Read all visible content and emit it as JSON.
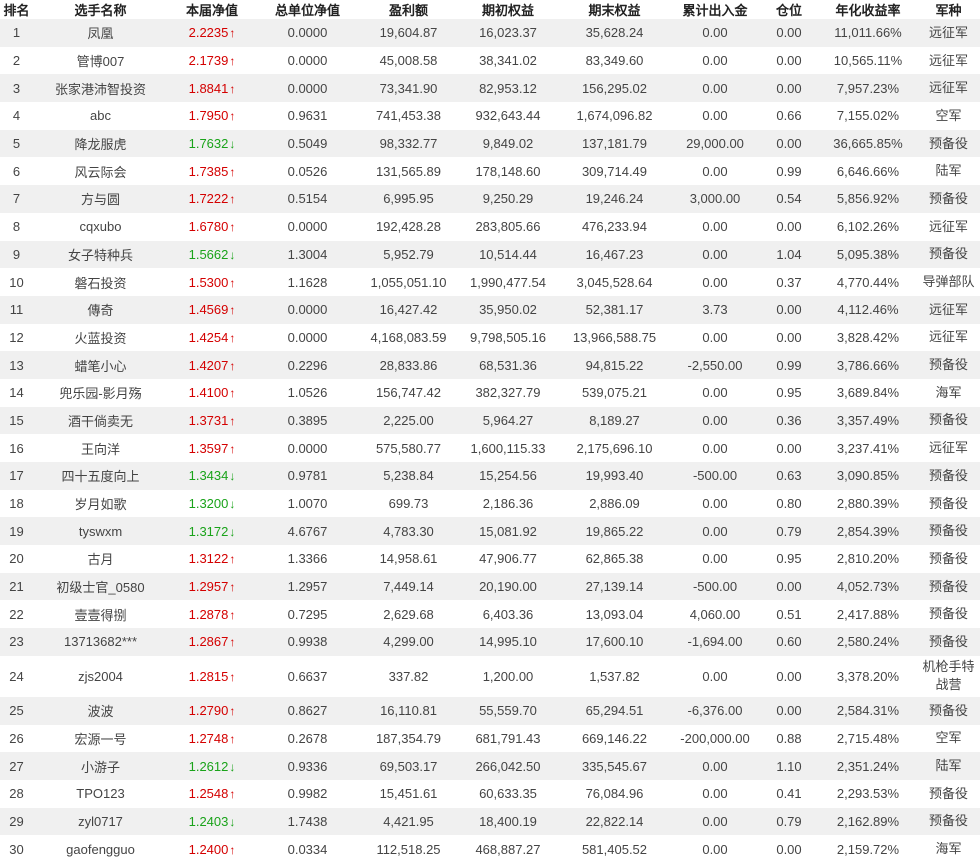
{
  "headers": [
    "排名",
    "选手名称",
    "本届净值",
    "总单位净值",
    "盈利额",
    "期初权益",
    "期末权益",
    "累计出入金",
    "仓位",
    "年化收益率",
    "军种"
  ],
  "rows": [
    {
      "rank": "1",
      "name": "凤凰",
      "nav": "2.2235",
      "trend": "up",
      "unit_nav": "0.0000",
      "profit": "19,604.87",
      "initial": "16,023.37",
      "final": "35,628.24",
      "flow": "0.00",
      "position": "0.00",
      "annual": "11,011.66%",
      "branch": "远征军"
    },
    {
      "rank": "2",
      "name": "管博007",
      "nav": "2.1739",
      "trend": "up",
      "unit_nav": "0.0000",
      "profit": "45,008.58",
      "initial": "38,341.02",
      "final": "83,349.60",
      "flow": "0.00",
      "position": "0.00",
      "annual": "10,565.11%",
      "branch": "远征军"
    },
    {
      "rank": "3",
      "name": "张家港沛智投资",
      "nav": "1.8841",
      "trend": "up",
      "unit_nav": "0.0000",
      "profit": "73,341.90",
      "initial": "82,953.12",
      "final": "156,295.02",
      "flow": "0.00",
      "position": "0.00",
      "annual": "7,957.23%",
      "branch": "远征军"
    },
    {
      "rank": "4",
      "name": "abc",
      "nav": "1.7950",
      "trend": "up",
      "unit_nav": "0.9631",
      "profit": "741,453.38",
      "initial": "932,643.44",
      "final": "1,674,096.82",
      "flow": "0.00",
      "position": "0.66",
      "annual": "7,155.02%",
      "branch": "空军"
    },
    {
      "rank": "5",
      "name": "降龙服虎",
      "nav": "1.7632",
      "trend": "down",
      "unit_nav": "0.5049",
      "profit": "98,332.77",
      "initial": "9,849.02",
      "final": "137,181.79",
      "flow": "29,000.00",
      "position": "0.00",
      "annual": "36,665.85%",
      "branch": "预备役"
    },
    {
      "rank": "6",
      "name": "风云际会",
      "nav": "1.7385",
      "trend": "up",
      "unit_nav": "0.0526",
      "profit": "131,565.89",
      "initial": "178,148.60",
      "final": "309,714.49",
      "flow": "0.00",
      "position": "0.99",
      "annual": "6,646.66%",
      "branch": "陆军"
    },
    {
      "rank": "7",
      "name": "方与圆",
      "nav": "1.7222",
      "trend": "up",
      "unit_nav": "0.5154",
      "profit": "6,995.95",
      "initial": "9,250.29",
      "final": "19,246.24",
      "flow": "3,000.00",
      "position": "0.54",
      "annual": "5,856.92%",
      "branch": "预备役"
    },
    {
      "rank": "8",
      "name": "cqxubo",
      "nav": "1.6780",
      "trend": "up",
      "unit_nav": "0.0000",
      "profit": "192,428.28",
      "initial": "283,805.66",
      "final": "476,233.94",
      "flow": "0.00",
      "position": "0.00",
      "annual": "6,102.26%",
      "branch": "远征军"
    },
    {
      "rank": "9",
      "name": "女子特种兵",
      "nav": "1.5662",
      "trend": "down",
      "unit_nav": "1.3004",
      "profit": "5,952.79",
      "initial": "10,514.44",
      "final": "16,467.23",
      "flow": "0.00",
      "position": "1.04",
      "annual": "5,095.38%",
      "branch": "预备役"
    },
    {
      "rank": "10",
      "name": "磐石投资",
      "nav": "1.5300",
      "trend": "up",
      "unit_nav": "1.1628",
      "profit": "1,055,051.10",
      "initial": "1,990,477.54",
      "final": "3,045,528.64",
      "flow": "0.00",
      "position": "0.37",
      "annual": "4,770.44%",
      "branch": "导弹部队"
    },
    {
      "rank": "11",
      "name": "傳奇",
      "nav": "1.4569",
      "trend": "up",
      "unit_nav": "0.0000",
      "profit": "16,427.42",
      "initial": "35,950.02",
      "final": "52,381.17",
      "flow": "3.73",
      "position": "0.00",
      "annual": "4,112.46%",
      "branch": "远征军"
    },
    {
      "rank": "12",
      "name": "火蓝投资",
      "nav": "1.4254",
      "trend": "up",
      "unit_nav": "0.0000",
      "profit": "4,168,083.59",
      "initial": "9,798,505.16",
      "final": "13,966,588.75",
      "flow": "0.00",
      "position": "0.00",
      "annual": "3,828.42%",
      "branch": "远征军"
    },
    {
      "rank": "13",
      "name": "蜡笔小心",
      "nav": "1.4207",
      "trend": "up",
      "unit_nav": "0.2296",
      "profit": "28,833.86",
      "initial": "68,531.36",
      "final": "94,815.22",
      "flow": "-2,550.00",
      "position": "0.99",
      "annual": "3,786.66%",
      "branch": "预备役"
    },
    {
      "rank": "14",
      "name": "兜乐园-影月殇",
      "nav": "1.4100",
      "trend": "up",
      "unit_nav": "1.0526",
      "profit": "156,747.42",
      "initial": "382,327.79",
      "final": "539,075.21",
      "flow": "0.00",
      "position": "0.95",
      "annual": "3,689.84%",
      "branch": "海军"
    },
    {
      "rank": "15",
      "name": "酒干倘卖无",
      "nav": "1.3731",
      "trend": "up",
      "unit_nav": "0.3895",
      "profit": "2,225.00",
      "initial": "5,964.27",
      "final": "8,189.27",
      "flow": "0.00",
      "position": "0.36",
      "annual": "3,357.49%",
      "branch": "预备役"
    },
    {
      "rank": "16",
      "name": "王向洋",
      "nav": "1.3597",
      "trend": "up",
      "unit_nav": "0.0000",
      "profit": "575,580.77",
      "initial": "1,600,115.33",
      "final": "2,175,696.10",
      "flow": "0.00",
      "position": "0.00",
      "annual": "3,237.41%",
      "branch": "远征军"
    },
    {
      "rank": "17",
      "name": "四十五度向上",
      "nav": "1.3434",
      "trend": "down",
      "unit_nav": "0.9781",
      "profit": "5,238.84",
      "initial": "15,254.56",
      "final": "19,993.40",
      "flow": "-500.00",
      "position": "0.63",
      "annual": "3,090.85%",
      "branch": "预备役"
    },
    {
      "rank": "18",
      "name": "岁月如歌",
      "nav": "1.3200",
      "trend": "down",
      "unit_nav": "1.0070",
      "profit": "699.73",
      "initial": "2,186.36",
      "final": "2,886.09",
      "flow": "0.00",
      "position": "0.80",
      "annual": "2,880.39%",
      "branch": "预备役"
    },
    {
      "rank": "19",
      "name": "tyswxm",
      "nav": "1.3172",
      "trend": "down",
      "unit_nav": "4.6767",
      "profit": "4,783.30",
      "initial": "15,081.92",
      "final": "19,865.22",
      "flow": "0.00",
      "position": "0.79",
      "annual": "2,854.39%",
      "branch": "预备役"
    },
    {
      "rank": "20",
      "name": "古月",
      "nav": "1.3122",
      "trend": "up",
      "unit_nav": "1.3366",
      "profit": "14,958.61",
      "initial": "47,906.77",
      "final": "62,865.38",
      "flow": "0.00",
      "position": "0.95",
      "annual": "2,810.20%",
      "branch": "预备役"
    },
    {
      "rank": "21",
      "name": "初级士官_0580",
      "nav": "1.2957",
      "trend": "up",
      "unit_nav": "1.2957",
      "profit": "7,449.14",
      "initial": "20,190.00",
      "final": "27,139.14",
      "flow": "-500.00",
      "position": "0.00",
      "annual": "4,052.73%",
      "branch": "预备役"
    },
    {
      "rank": "22",
      "name": "壹壹得捌",
      "nav": "1.2878",
      "trend": "up",
      "unit_nav": "0.7295",
      "profit": "2,629.68",
      "initial": "6,403.36",
      "final": "13,093.04",
      "flow": "4,060.00",
      "position": "0.51",
      "annual": "2,417.88%",
      "branch": "预备役"
    },
    {
      "rank": "23",
      "name": "13713682***",
      "nav": "1.2867",
      "trend": "up",
      "unit_nav": "0.9938",
      "profit": "4,299.00",
      "initial": "14,995.10",
      "final": "17,600.10",
      "flow": "-1,694.00",
      "position": "0.60",
      "annual": "2,580.24%",
      "branch": "预备役"
    },
    {
      "rank": "24",
      "name": "zjs2004",
      "nav": "1.2815",
      "trend": "up",
      "unit_nav": "0.6637",
      "profit": "337.82",
      "initial": "1,200.00",
      "final": "1,537.82",
      "flow": "0.00",
      "position": "0.00",
      "annual": "3,378.20%",
      "branch": "机枪手特战营"
    },
    {
      "rank": "25",
      "name": "波波",
      "nav": "1.2790",
      "trend": "up",
      "unit_nav": "0.8627",
      "profit": "16,110.81",
      "initial": "55,559.70",
      "final": "65,294.51",
      "flow": "-6,376.00",
      "position": "0.00",
      "annual": "2,584.31%",
      "branch": "预备役"
    },
    {
      "rank": "26",
      "name": "宏源一号",
      "nav": "1.2748",
      "trend": "up",
      "unit_nav": "0.2678",
      "profit": "187,354.79",
      "initial": "681,791.43",
      "final": "669,146.22",
      "flow": "-200,000.00",
      "position": "0.88",
      "annual": "2,715.48%",
      "branch": "空军"
    },
    {
      "rank": "27",
      "name": "小游子",
      "nav": "1.2612",
      "trend": "down",
      "unit_nav": "0.9336",
      "profit": "69,503.17",
      "initial": "266,042.50",
      "final": "335,545.67",
      "flow": "0.00",
      "position": "1.10",
      "annual": "2,351.24%",
      "branch": "陆军"
    },
    {
      "rank": "28",
      "name": "TPO123",
      "nav": "1.2548",
      "trend": "up",
      "unit_nav": "0.9982",
      "profit": "15,451.61",
      "initial": "60,633.35",
      "final": "76,084.96",
      "flow": "0.00",
      "position": "0.41",
      "annual": "2,293.53%",
      "branch": "预备役"
    },
    {
      "rank": "29",
      "name": "zyl0717",
      "nav": "1.2403",
      "trend": "down",
      "unit_nav": "1.7438",
      "profit": "4,421.95",
      "initial": "18,400.19",
      "final": "22,822.14",
      "flow": "0.00",
      "position": "0.79",
      "annual": "2,162.89%",
      "branch": "预备役"
    },
    {
      "rank": "30",
      "name": "gaofengguo",
      "nav": "1.2400",
      "trend": "up",
      "unit_nav": "0.0334",
      "profit": "112,518.25",
      "initial": "468,887.27",
      "final": "581,405.52",
      "flow": "0.00",
      "position": "0.00",
      "annual": "2,159.72%",
      "branch": "海军"
    }
  ],
  "colors": {
    "up": "#d40000",
    "down": "#1aa31a",
    "alt_row": "#f0f0f0"
  },
  "icons": {
    "up": "arrow-up-icon",
    "down": "arrow-down-icon"
  }
}
